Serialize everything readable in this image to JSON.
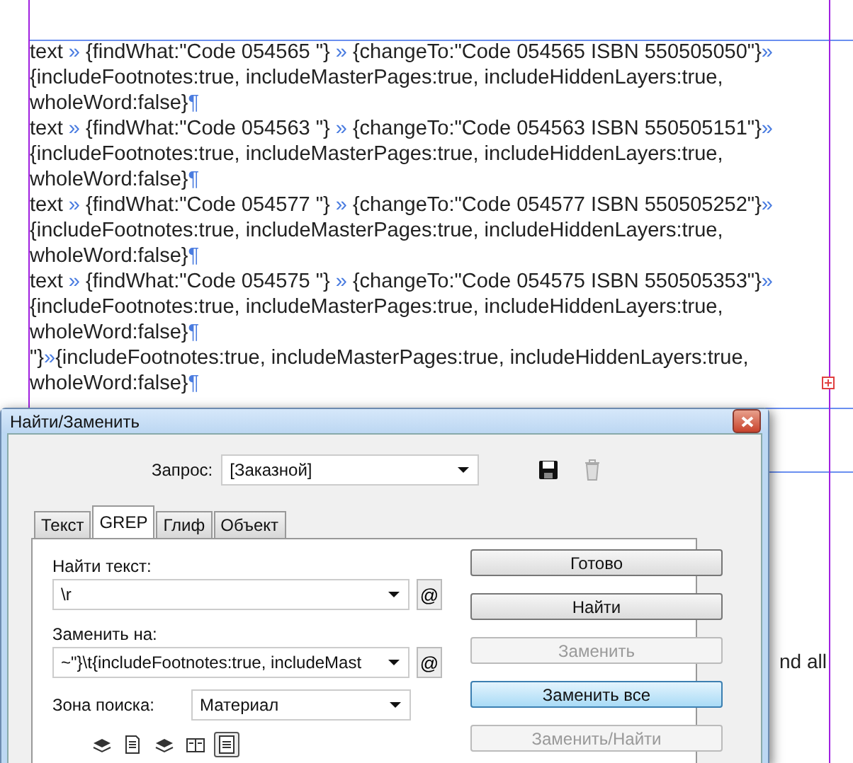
{
  "document": {
    "paragraphs": [
      {
        "parts": [
          {
            "kind": "text",
            "text": "text "
          },
          {
            "kind": "marker",
            "text": "» "
          },
          {
            "kind": "text",
            "text": "{findWhat:\"Code 054565 \"} "
          },
          {
            "kind": "marker",
            "text": "» "
          },
          {
            "kind": "text",
            "text": "{changeTo:\"Code 054565 ISBN 550505050\"}"
          },
          {
            "kind": "marker",
            "text": "» "
          },
          {
            "kind": "text",
            "text": "{includeFootnotes:true, includeMasterPages:true, includeHiddenLayers:true, wholeWord:false}"
          },
          {
            "kind": "marker",
            "text": "¶"
          }
        ]
      },
      {
        "parts": [
          {
            "kind": "text",
            "text": "text "
          },
          {
            "kind": "marker",
            "text": "» "
          },
          {
            "kind": "text",
            "text": "{findWhat:\"Code 054563 \"} "
          },
          {
            "kind": "marker",
            "text": "» "
          },
          {
            "kind": "text",
            "text": "{changeTo:\"Code 054563 ISBN 550505151\"}"
          },
          {
            "kind": "marker",
            "text": "» "
          },
          {
            "kind": "text",
            "text": "{includeFootnotes:true, includeMasterPages:true, includeHiddenLayers:true, wholeWord:false}"
          },
          {
            "kind": "marker",
            "text": "¶"
          }
        ]
      },
      {
        "parts": [
          {
            "kind": "text",
            "text": "text "
          },
          {
            "kind": "marker",
            "text": "» "
          },
          {
            "kind": "text",
            "text": "{findWhat:\"Code 054577 \"} "
          },
          {
            "kind": "marker",
            "text": "» "
          },
          {
            "kind": "text",
            "text": "{changeTo:\"Code 054577 ISBN 550505252\"}"
          },
          {
            "kind": "marker",
            "text": "» "
          },
          {
            "kind": "text",
            "text": "{includeFootnotes:true, includeMasterPages:true, includeHiddenLayers:true, wholeWord:false}"
          },
          {
            "kind": "marker",
            "text": "¶"
          }
        ]
      },
      {
        "parts": [
          {
            "kind": "text",
            "text": "text "
          },
          {
            "kind": "marker",
            "text": "» "
          },
          {
            "kind": "text",
            "text": "{findWhat:\"Code 054575 \"} "
          },
          {
            "kind": "marker",
            "text": "» "
          },
          {
            "kind": "text",
            "text": "{changeTo:\"Code 054575 ISBN 550505353\"}"
          },
          {
            "kind": "marker",
            "text": "» "
          },
          {
            "kind": "text",
            "text": "{includeFootnotes:true, includeMasterPages:true, includeHiddenLayers:true, wholeWord:false}"
          },
          {
            "kind": "marker",
            "text": "¶"
          }
        ]
      },
      {
        "parts": [
          {
            "kind": "text",
            "text": "\"}"
          },
          {
            "kind": "marker",
            "text": "»"
          },
          {
            "kind": "text",
            "text": "{includeFootnotes:true, includeMasterPages:true, includeHiddenLayers:true, wholeWord:false}"
          },
          {
            "kind": "marker",
            "text": "¶"
          }
        ]
      }
    ],
    "partial_text": "nd all"
  },
  "dialog": {
    "title": "Найти/Заменить",
    "query": {
      "label": "Запрос:",
      "value": "[Заказной]"
    },
    "tabs": [
      {
        "label": "Текст",
        "selected": false
      },
      {
        "label": "GREP",
        "selected": true
      },
      {
        "label": "Глиф",
        "selected": false
      },
      {
        "label": "Объект",
        "selected": false
      }
    ],
    "find": {
      "label": "Найти текст:",
      "value": "\\r",
      "special_button": "@"
    },
    "replace": {
      "label": "Заменить на:",
      "value": "~\"}\\t{includeFootnotes:true, includeMast",
      "special_button": "@"
    },
    "scope": {
      "label": "Зона поиска:",
      "value": "Материал"
    },
    "options": [
      {
        "kind": "layers",
        "selected": false
      },
      {
        "kind": "page",
        "selected": false
      },
      {
        "kind": "layers",
        "selected": false
      },
      {
        "kind": "book",
        "selected": false
      },
      {
        "kind": "note",
        "selected": true
      }
    ],
    "buttons": [
      {
        "label": "Готово",
        "disabled": false,
        "default": false
      },
      {
        "label": "Найти",
        "disabled": false,
        "default": false
      },
      {
        "label": "Заменить",
        "disabled": true,
        "default": false
      },
      {
        "label": "Заменить все",
        "disabled": false,
        "default": true
      },
      {
        "label": "Заменить/Найти",
        "disabled": true,
        "default": false
      }
    ]
  }
}
